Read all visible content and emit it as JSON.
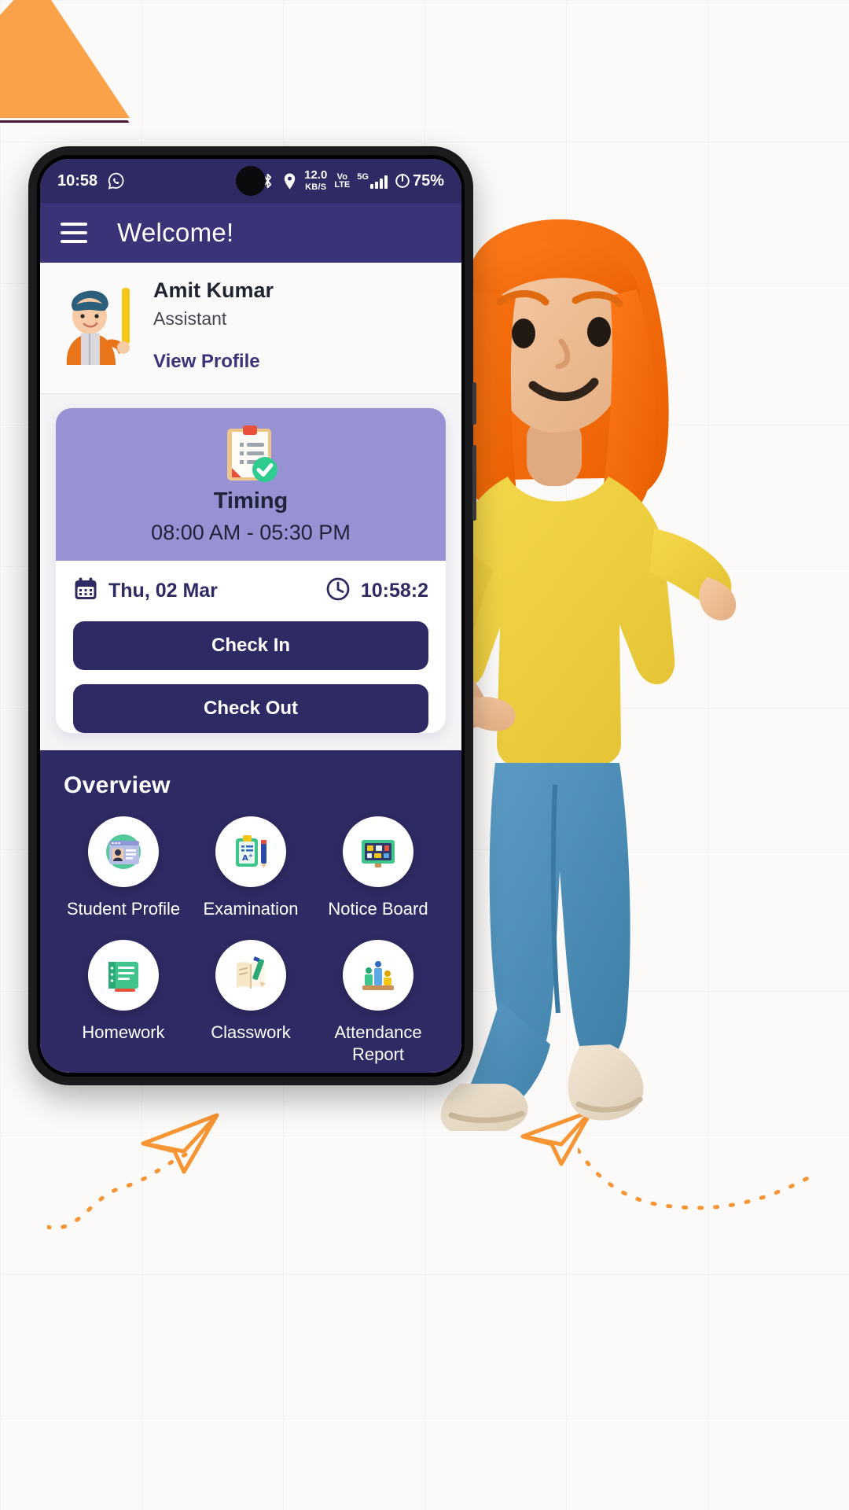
{
  "phone": {
    "statusbar": {
      "time": "10:58",
      "whatsapp_icon": "whatsapp-icon",
      "alarm_icon": "alarm-icon",
      "bluetooth_icon": "bluetooth-icon",
      "location_icon": "location-pin-icon",
      "data_rate": "12.0",
      "data_rate_unit": "KB/S",
      "volte_line1": "Vo",
      "volte_line2": "LTE",
      "network": "5G",
      "battery": "75%"
    },
    "appbar": {
      "menu_icon": "hamburger-menu-icon",
      "title": "Welcome!"
    },
    "profile": {
      "avatar_icon": "teacher-avatar",
      "name": "Amit Kumar",
      "role": "Assistant",
      "view_profile_label": "View Profile"
    },
    "timing_card": {
      "icon": "clipboard-check-icon",
      "label": "Timing",
      "range": "08:00 AM - 05:30 PM",
      "calendar_icon": "calendar-icon",
      "date": "Thu, 02 Mar",
      "clock_icon": "clock-icon",
      "clock_time": "10:58:2",
      "check_in_label": "Check In",
      "check_out_label": "Check Out"
    },
    "overview": {
      "title": "Overview",
      "tiles": [
        {
          "label": "Student Profile",
          "icon": "id-card-icon"
        },
        {
          "label": "Examination",
          "icon": "exam-clipboard-icon"
        },
        {
          "label": "Notice Board",
          "icon": "notice-board-icon"
        },
        {
          "label": "Homework",
          "icon": "homework-book-icon"
        },
        {
          "label": "Classwork",
          "icon": "notebook-pencil-icon"
        },
        {
          "label": "Attendance Report",
          "icon": "attendance-chart-icon"
        }
      ]
    }
  },
  "decor": {
    "triangle_icon": "orange-triangle-shape",
    "plane_left_icon": "paper-plane-icon",
    "plane_right_icon": "paper-plane-icon",
    "character_icon": "3d-person-illustration"
  },
  "colors": {
    "primary": "#2E2A63",
    "appbar": "#3A3377",
    "timing_card": "#9792D4",
    "accent_orange": "#F9A24A",
    "page_bg": "#FBFAF8"
  }
}
